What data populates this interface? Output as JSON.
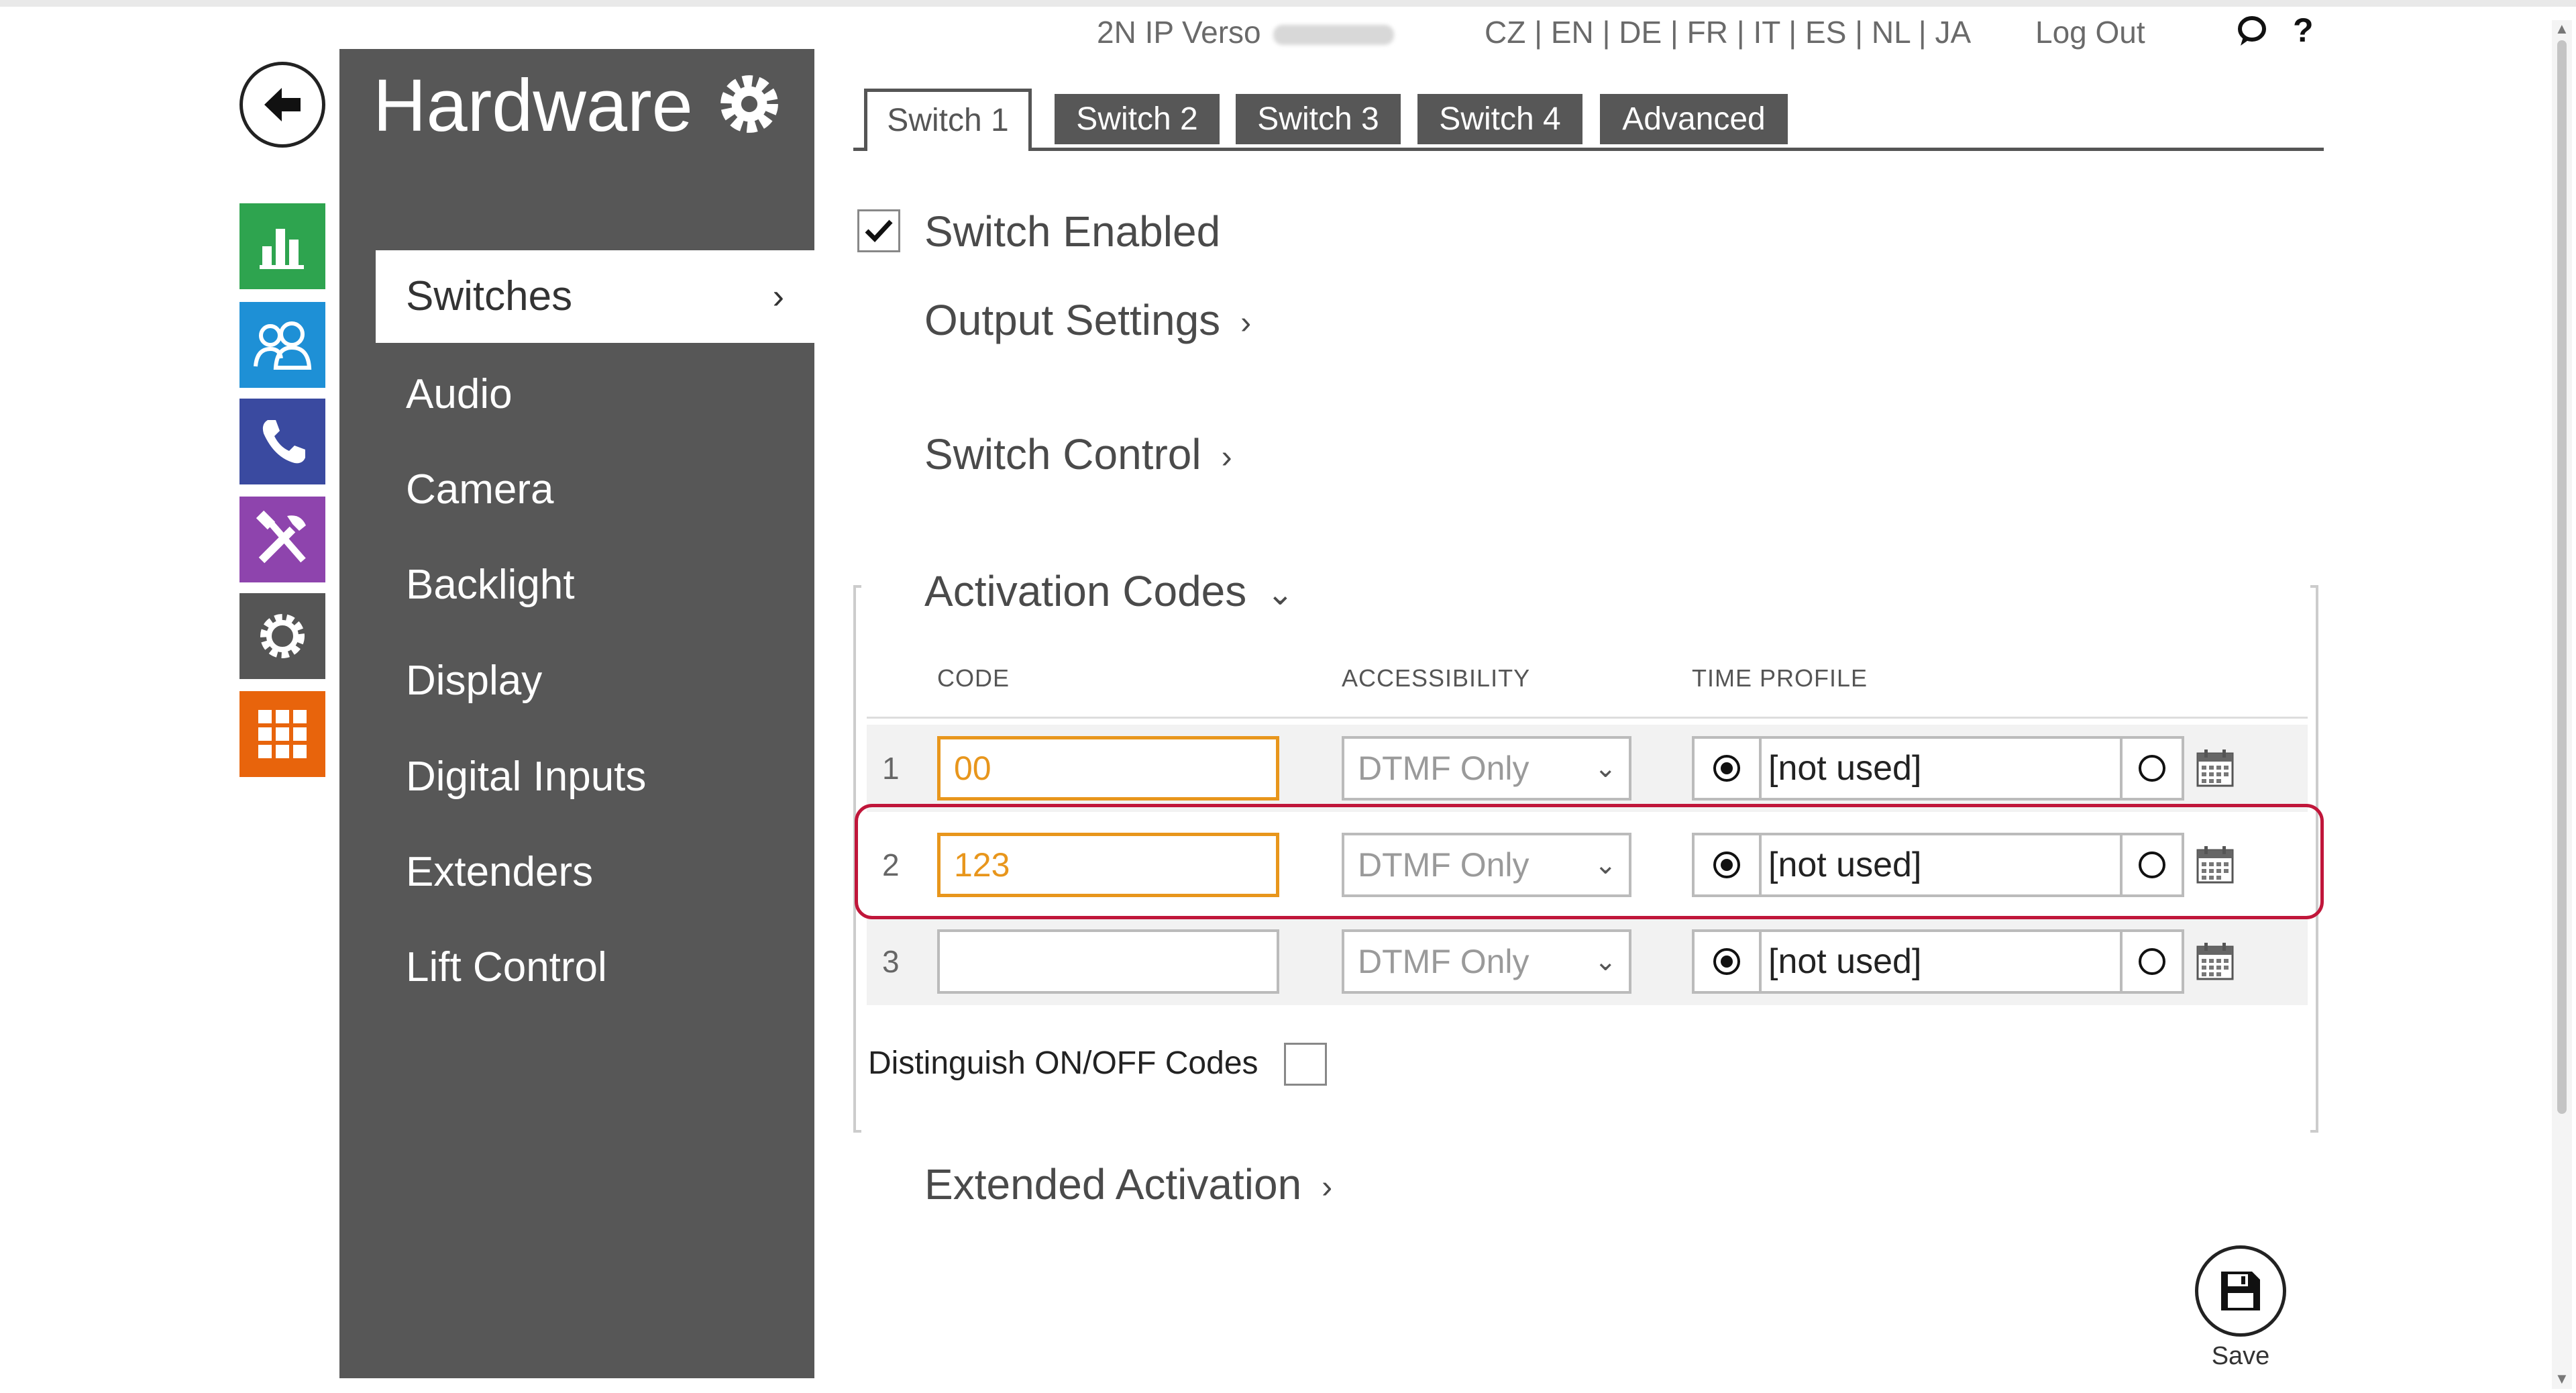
{
  "header": {
    "device_name": "2N IP Verso",
    "languages": "CZ | EN | DE | FR | IT | ES | NL | JA",
    "logout_label": "Log Out",
    "help_label": "?"
  },
  "rail": {
    "back_icon": "arrow-left-icon",
    "items": [
      {
        "icon": "status-chart-icon",
        "color": "#2ea44f"
      },
      {
        "icon": "directory-users-icon",
        "color": "#1e90d6"
      },
      {
        "icon": "phone-icon",
        "color": "#3a4aa0"
      },
      {
        "icon": "hardware-tools-icon",
        "color": "#8e44ad"
      },
      {
        "icon": "settings-gear-icon",
        "color": "#555555"
      },
      {
        "icon": "services-grid-icon",
        "color": "#e8640c"
      }
    ]
  },
  "sidebar": {
    "title": "Hardware",
    "items": [
      {
        "label": "Switches",
        "active": true,
        "chevron": "›"
      },
      {
        "label": "Audio"
      },
      {
        "label": "Camera"
      },
      {
        "label": "Backlight"
      },
      {
        "label": "Display"
      },
      {
        "label": "Digital Inputs"
      },
      {
        "label": "Extenders"
      },
      {
        "label": "Lift Control"
      }
    ]
  },
  "tabs": [
    {
      "label": "Switch 1",
      "active": true
    },
    {
      "label": "Switch 2"
    },
    {
      "label": "Switch 3"
    },
    {
      "label": "Switch 4"
    },
    {
      "label": "Advanced"
    }
  ],
  "main": {
    "switch_enabled_label": "Switch Enabled",
    "switch_enabled": true,
    "output_settings_label": "Output Settings",
    "switch_control_label": "Switch Control",
    "activation_codes_label": "Activation Codes",
    "columns": {
      "code": "CODE",
      "accessibility": "ACCESSIBILITY",
      "time_profile": "TIME PROFILE"
    },
    "rows": [
      {
        "num": "1",
        "code": "00",
        "accessibility": "DTMF Only",
        "time_profile": "[not used]"
      },
      {
        "num": "2",
        "code": "123",
        "accessibility": "DTMF Only",
        "time_profile": "[not used]"
      },
      {
        "num": "3",
        "code": "",
        "accessibility": "DTMF Only",
        "time_profile": "[not used]"
      }
    ],
    "distinguish_label": "Distinguish ON/OFF Codes",
    "extended_activation_label": "Extended Activation"
  },
  "save": {
    "label": "Save"
  },
  "colors": {
    "accent_orange": "#e8961c",
    "highlight_red": "#c0163a",
    "sidebar_gray": "#575757"
  }
}
